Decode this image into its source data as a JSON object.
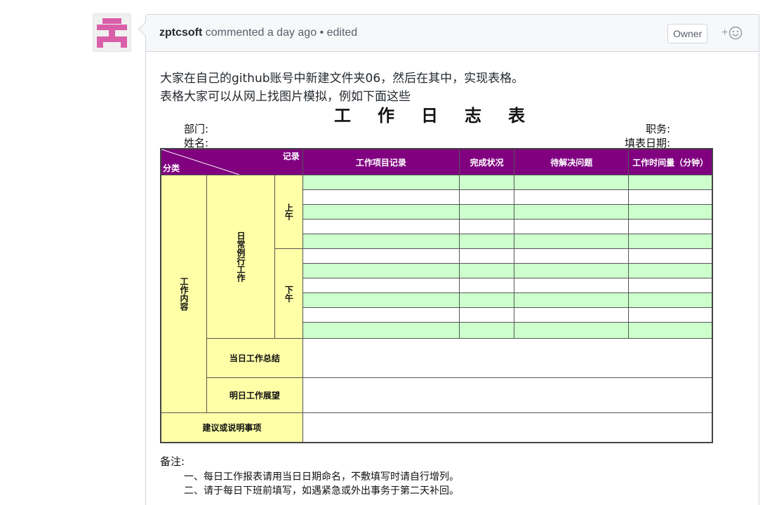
{
  "comment": {
    "author": "zptcsoft",
    "action": "commented a day ago",
    "edited": "• edited",
    "badge": "Owner",
    "reaction_prefix": "+",
    "body_lines": [
      "大家在自己的github账号中新建文件夹06，然后在其中，实现表格。",
      "表格大家可以从网上找图片模拟，例如下面这些"
    ]
  },
  "form": {
    "title": "工作日志表",
    "dept_label": "部门:",
    "name_label": "姓名:",
    "position_label": "职务:",
    "date_label": "填表日期:",
    "header": {
      "record": "记录",
      "category": "分类",
      "work_items": "工作项目记录",
      "status": "完成状况",
      "pending": "待解决问题",
      "time_spent": "工作时间量（分钟）"
    },
    "sections": {
      "work_content": "工作内容",
      "daily_routine": "日常例行工作",
      "morning": "上午",
      "afternoon": "下午",
      "today_summary": "当日工作总结",
      "tomorrow_plan": "明日工作展望",
      "suggestions": "建议或说明事项"
    },
    "notes_title": "备注:",
    "notes": [
      "一、每日工作报表请用当日日期命名，不敷填写时请自行增列。",
      "二、请于每日下班前填写，如遇紧急或外出事务于第二天补回。"
    ]
  },
  "colors": {
    "header_purple": "#800080",
    "row_green": "#ccffcc",
    "label_yellow": "#ffffa8",
    "avatar_pink": "#d95fa8"
  },
  "icons": {
    "avatar": "identicon-avatar",
    "reaction": "smiley-icon"
  }
}
